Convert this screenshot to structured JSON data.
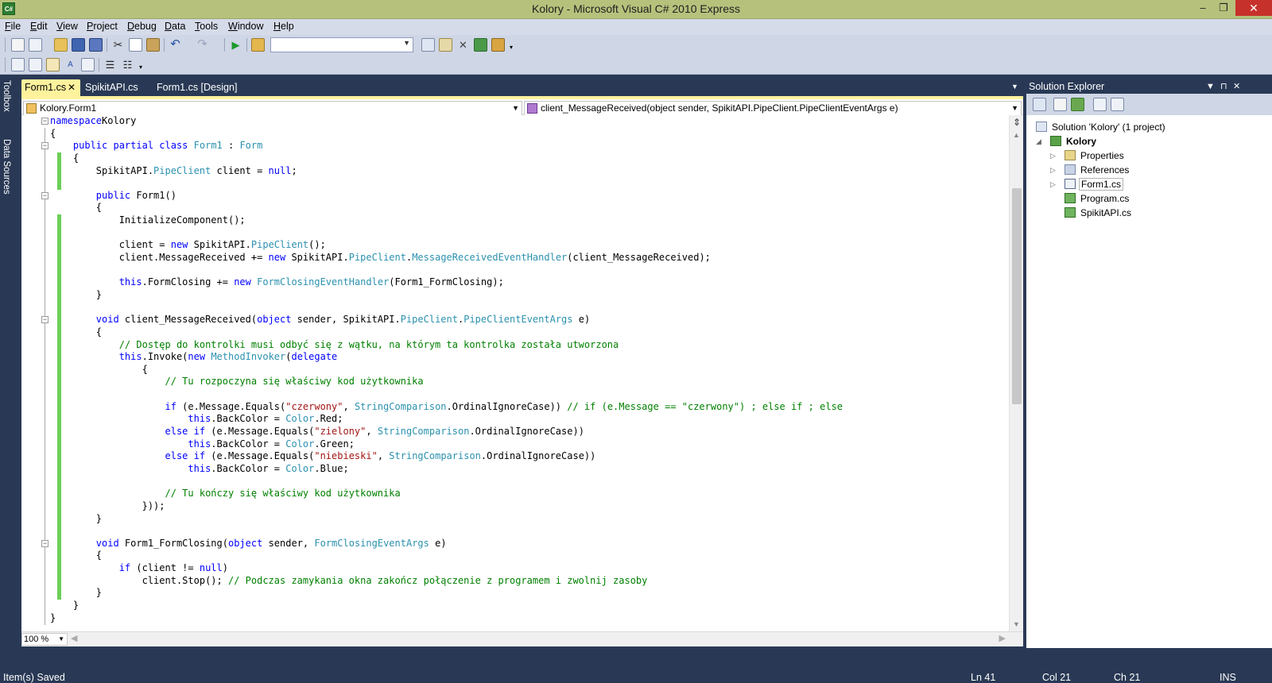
{
  "window": {
    "title": "Kolory - Microsoft Visual C# 2010 Express",
    "app_icon_text": "C#",
    "minimize": "–",
    "maximize": "❐",
    "close": "✕"
  },
  "menu": [
    "File",
    "Edit",
    "View",
    "Project",
    "Debug",
    "Data",
    "Tools",
    "Window",
    "Help"
  ],
  "toolbar": {
    "config_combo_value": "",
    "icons": [
      "new-project-icon",
      "add-item-icon",
      "open-file-icon",
      "save-icon",
      "save-all-icon",
      "cut-icon",
      "copy-icon",
      "paste-icon",
      "undo-icon",
      "redo-icon",
      "start-debugging-icon",
      "find-in-files-icon"
    ]
  },
  "side_tabs": [
    "Toolbox",
    "Data Sources"
  ],
  "tabs": [
    {
      "label": "Form1.cs",
      "active": true
    },
    {
      "label": "SpikitAPI.cs",
      "active": false
    },
    {
      "label": "Form1.cs [Design]",
      "active": false
    }
  ],
  "tab_close": "✕",
  "navbar": {
    "type_combo": "Kolory.Form1",
    "member_combo": "client_MessageReceived(object sender, SpikitAPI.PipeClient.PipeClientEventArgs e)"
  },
  "code_lines": [
    [
      [
        "kw",
        "namespace"
      ],
      [
        "",
        "Kolory"
      ]
    ],
    [
      [
        "",
        "{"
      ]
    ],
    [
      [
        "",
        "    "
      ],
      [
        "kw",
        "public partial class"
      ],
      [
        "",
        " "
      ],
      [
        "ty",
        "Form1"
      ],
      [
        "",
        " : "
      ],
      [
        "ty",
        "Form"
      ]
    ],
    [
      [
        "",
        "    {"
      ]
    ],
    [
      [
        "",
        "        SpikitAPI."
      ],
      [
        "ty",
        "PipeClient"
      ],
      [
        "",
        " client = "
      ],
      [
        "kw",
        "null"
      ],
      [
        "",
        ";"
      ]
    ],
    [
      [
        "",
        ""
      ]
    ],
    [
      [
        "",
        "        "
      ],
      [
        "kw",
        "public"
      ],
      [
        "",
        " Form1()"
      ]
    ],
    [
      [
        "",
        "        {"
      ]
    ],
    [
      [
        "",
        "            InitializeComponent();"
      ]
    ],
    [
      [
        "",
        ""
      ]
    ],
    [
      [
        "",
        "            client = "
      ],
      [
        "kw",
        "new"
      ],
      [
        "",
        " SpikitAPI."
      ],
      [
        "ty",
        "PipeClient"
      ],
      [
        "",
        "();"
      ]
    ],
    [
      [
        "",
        "            client.MessageReceived += "
      ],
      [
        "kw",
        "new"
      ],
      [
        "",
        " SpikitAPI."
      ],
      [
        "ty",
        "PipeClient"
      ],
      [
        "",
        "."
      ],
      [
        "ty",
        "MessageReceivedEventHandler"
      ],
      [
        "",
        "(client_MessageReceived);"
      ]
    ],
    [
      [
        "",
        ""
      ]
    ],
    [
      [
        "",
        "            "
      ],
      [
        "kw",
        "this"
      ],
      [
        "",
        ".FormClosing += "
      ],
      [
        "kw",
        "new"
      ],
      [
        "",
        " "
      ],
      [
        "ty",
        "FormClosingEventHandler"
      ],
      [
        "",
        "(Form1_FormClosing);"
      ]
    ],
    [
      [
        "",
        "        }"
      ]
    ],
    [
      [
        "",
        ""
      ]
    ],
    [
      [
        "",
        "        "
      ],
      [
        "kw",
        "void"
      ],
      [
        "",
        " client_MessageReceived("
      ],
      [
        "kw",
        "object"
      ],
      [
        "",
        " sender, SpikitAPI."
      ],
      [
        "ty",
        "PipeClient"
      ],
      [
        "",
        "."
      ],
      [
        "ty",
        "PipeClientEventArgs"
      ],
      [
        "",
        " e)"
      ]
    ],
    [
      [
        "",
        "        {"
      ]
    ],
    [
      [
        "",
        "            "
      ],
      [
        "cm",
        "// Dostęp do kontrolki musi odbyć się z wątku, na którym ta kontrolka została utworzona"
      ]
    ],
    [
      [
        "",
        "            "
      ],
      [
        "kw",
        "this"
      ],
      [
        "",
        ".Invoke("
      ],
      [
        "kw",
        "new"
      ],
      [
        "",
        " "
      ],
      [
        "ty",
        "MethodInvoker"
      ],
      [
        "",
        "("
      ],
      [
        "kw",
        "delegate"
      ]
    ],
    [
      [
        "",
        "                {"
      ]
    ],
    [
      [
        "",
        "                    "
      ],
      [
        "cm",
        "// Tu rozpoczyna się właściwy kod użytkownika"
      ]
    ],
    [
      [
        "",
        ""
      ]
    ],
    [
      [
        "",
        "                    "
      ],
      [
        "kw",
        "if"
      ],
      [
        "",
        " (e.Message.Equals("
      ],
      [
        "st",
        "\"czerwony\""
      ],
      [
        "",
        ", "
      ],
      [
        "ty",
        "StringComparison"
      ],
      [
        "",
        ".OrdinalIgnoreCase)) "
      ],
      [
        "cm",
        "// if (e.Message == \"czerwony\") ; else if ; else"
      ]
    ],
    [
      [
        "",
        "                        "
      ],
      [
        "kw",
        "this"
      ],
      [
        "",
        ".BackColor = "
      ],
      [
        "ty",
        "Color"
      ],
      [
        "",
        ".Red;"
      ]
    ],
    [
      [
        "",
        "                    "
      ],
      [
        "kw",
        "else if"
      ],
      [
        "",
        " (e.Message.Equals("
      ],
      [
        "st",
        "\"zielony\""
      ],
      [
        "",
        ", "
      ],
      [
        "ty",
        "StringComparison"
      ],
      [
        "",
        ".OrdinalIgnoreCase))"
      ]
    ],
    [
      [
        "",
        "                        "
      ],
      [
        "kw",
        "this"
      ],
      [
        "",
        ".BackColor = "
      ],
      [
        "ty",
        "Color"
      ],
      [
        "",
        ".Green;"
      ]
    ],
    [
      [
        "",
        "                    "
      ],
      [
        "kw",
        "else if"
      ],
      [
        "",
        " (e.Message.Equals("
      ],
      [
        "st",
        "\"niebieski\""
      ],
      [
        "",
        ", "
      ],
      [
        "ty",
        "StringComparison"
      ],
      [
        "",
        ".OrdinalIgnoreCase))"
      ]
    ],
    [
      [
        "",
        "                        "
      ],
      [
        "kw",
        "this"
      ],
      [
        "",
        ".BackColor = "
      ],
      [
        "ty",
        "Color"
      ],
      [
        "",
        ".Blue;"
      ]
    ],
    [
      [
        "",
        ""
      ]
    ],
    [
      [
        "",
        "                    "
      ],
      [
        "cm",
        "// Tu kończy się właściwy kod użytkownika"
      ]
    ],
    [
      [
        "",
        "                }));"
      ]
    ],
    [
      [
        "",
        "        }"
      ]
    ],
    [
      [
        "",
        ""
      ]
    ],
    [
      [
        "",
        "        "
      ],
      [
        "kw",
        "void"
      ],
      [
        "",
        " Form1_FormClosing("
      ],
      [
        "kw",
        "object"
      ],
      [
        "",
        " sender, "
      ],
      [
        "ty",
        "FormClosingEventArgs"
      ],
      [
        "",
        " e)"
      ]
    ],
    [
      [
        "",
        "        {"
      ]
    ],
    [
      [
        "",
        "            "
      ],
      [
        "kw",
        "if"
      ],
      [
        "",
        " (client != "
      ],
      [
        "kw",
        "null"
      ],
      [
        "",
        ")"
      ]
    ],
    [
      [
        "",
        "                client.Stop(); "
      ],
      [
        "cm",
        "// Podczas zamykania okna zakończ połączenie z programem i zwolnij zasoby"
      ]
    ],
    [
      [
        "",
        "        }"
      ]
    ],
    [
      [
        "",
        "    }"
      ]
    ],
    [
      [
        "",
        "}"
      ]
    ]
  ],
  "zoom": "100 %",
  "solution_explorer": {
    "title": "Solution Explorer",
    "items": [
      {
        "label": "Solution 'Kolory' (1 project)",
        "icon": "solution-icon",
        "level": 0,
        "expander": ""
      },
      {
        "label": "Kolory",
        "icon": "csharp-project-icon",
        "level": 1,
        "expander": "◢",
        "bold": true
      },
      {
        "label": "Properties",
        "icon": "properties-folder-icon",
        "level": 2,
        "expander": "▷"
      },
      {
        "label": "References",
        "icon": "references-folder-icon",
        "level": 2,
        "expander": "▷"
      },
      {
        "label": "Form1.cs",
        "icon": "form-file-icon",
        "level": 2,
        "expander": "▷",
        "selected": true
      },
      {
        "label": "Program.cs",
        "icon": "cs-file-icon",
        "level": 2,
        "expander": ""
      },
      {
        "label": "SpikitAPI.cs",
        "icon": "cs-file-icon",
        "level": 2,
        "expander": ""
      }
    ]
  },
  "status": {
    "message": "Item(s) Saved",
    "line": "Ln 41",
    "col": "Col 21",
    "ch": "Ch 21",
    "mode": "INS"
  },
  "colors": {
    "keyword": "#0000ff",
    "type": "#2b91af",
    "comment": "#008000",
    "string": "#a31515",
    "chrome": "#293955",
    "active_tab": "#fff29d",
    "change_marker": "#6ccf58"
  }
}
